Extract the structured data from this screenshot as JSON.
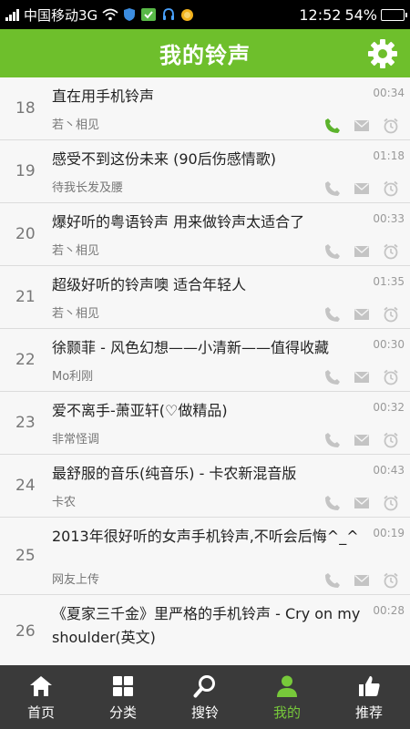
{
  "status_bar": {
    "carrier": "中国移动3G",
    "time": "12:52",
    "battery_percent": "54%",
    "battery_level": 0.54
  },
  "header": {
    "title": "我的铃声"
  },
  "songs": [
    {
      "index": "18",
      "title": "直在用手机铃声",
      "artist": "若丶相见",
      "duration": "00:34",
      "phone_active": true
    },
    {
      "index": "19",
      "title": "感受不到这份未来 (90后伤感情歌)",
      "artist": "待我长发及腰",
      "duration": "01:18",
      "phone_active": false
    },
    {
      "index": "20",
      "title": "爆好听的粤语铃声 用来做铃声太适合了",
      "artist": "若丶相见",
      "duration": "00:33",
      "phone_active": false
    },
    {
      "index": "21",
      "title": "超级好听的铃声噢 适合年轻人",
      "artist": "若丶相见",
      "duration": "01:35",
      "phone_active": false
    },
    {
      "index": "22",
      "title": "徐颢菲 - 风色幻想——小清新——值得收藏",
      "artist": "Mo利刚",
      "duration": "00:30",
      "phone_active": false
    },
    {
      "index": "23",
      "title": "爱不离手-萧亚轩(♡做精品)",
      "artist": "非常怪调",
      "duration": "00:32",
      "phone_active": false
    },
    {
      "index": "24",
      "title": "最舒服的音乐(纯音乐) - 卡农新混音版",
      "artist": "卡农",
      "duration": "00:43",
      "phone_active": false
    },
    {
      "index": "25",
      "title": "2013年很好听的女声手机铃声,不听会后悔^_^",
      "artist": "网友上传",
      "duration": "00:19",
      "phone_active": false
    },
    {
      "index": "26",
      "title": "《夏家三千金》里严格的手机铃声 - Cry on my shoulder(英文)",
      "artist": "",
      "duration": "00:28",
      "phone_active": false
    }
  ],
  "tabs": [
    {
      "label": "首页",
      "icon": "home-icon",
      "active": false
    },
    {
      "label": "分类",
      "icon": "grid-icon",
      "active": false
    },
    {
      "label": "搜铃",
      "icon": "search-icon",
      "active": false
    },
    {
      "label": "我的",
      "icon": "person-icon",
      "active": true
    },
    {
      "label": "推荐",
      "icon": "thumbs-up-icon",
      "active": false
    }
  ],
  "colors": {
    "accent": "#6ebf2c",
    "tab_active": "#77c93a",
    "tabbar_bg": "#3a3a3a",
    "icon_idle": "#c4c4c4",
    "phone_active": "#5cb32c"
  }
}
